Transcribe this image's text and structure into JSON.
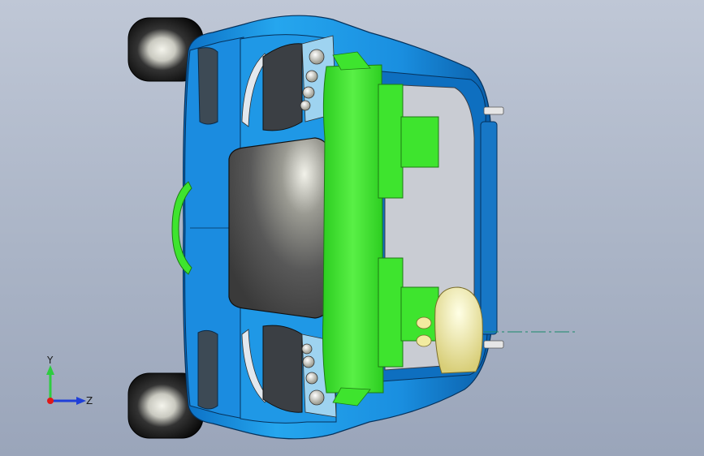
{
  "viewport": {
    "background_top": "#bfc7d6",
    "background_bottom": "#9aa5ba",
    "model": {
      "body_color": "#1e8fe0",
      "body_dark": "#0b5fa8",
      "green_part_color": "#3ee42e",
      "glass_color": "#4a4a4a",
      "tire_color": "#111111",
      "headlight_color": "#d8d8c8",
      "seat_color": "#f2eba0"
    }
  },
  "triad": {
    "y_label": "Y",
    "z_label": "Z",
    "y_color": "#2ecc40",
    "z_color": "#1f3fd8",
    "origin_color": "#e01818"
  }
}
